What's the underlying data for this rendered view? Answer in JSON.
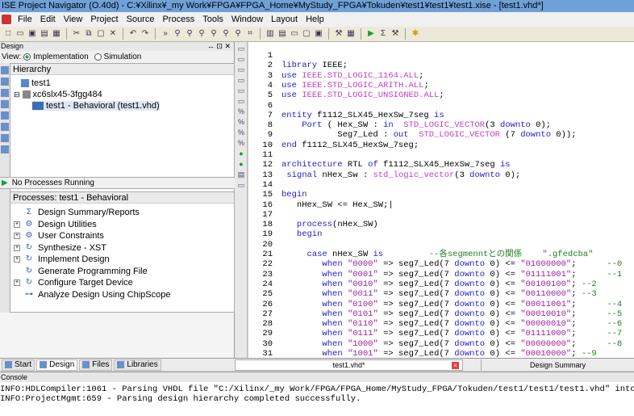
{
  "window": {
    "title": "ISE Project Navigator (O.40d) - C:¥Xilinx¥_my Work¥FPGA¥FPGA_Home¥MyStudy_FPGA¥Tokuden¥test1¥test1¥test1.xise - [test1.vhd*]"
  },
  "menu": [
    "File",
    "Edit",
    "View",
    "Project",
    "Source",
    "Process",
    "Tools",
    "Window",
    "Layout",
    "Help"
  ],
  "design_panel": {
    "header": "Design",
    "controls": "↔ ⊡ ✕",
    "view_label": "View:",
    "view_implementation": "Implementation",
    "view_simulation": "Simulation",
    "hierarchy_title": "Hierarchy",
    "tree": [
      {
        "label": "test1"
      },
      {
        "label": "xc6slx45-3fgg484"
      },
      {
        "label": "test1 - Behavioral (test1.vhd)"
      }
    ],
    "no_processes": "No Processes Running",
    "processes_title": "Processes: test1 - Behavioral",
    "processes": [
      {
        "label": "Design Summary/Reports",
        "expander": false,
        "icon": "Σ"
      },
      {
        "label": "Design Utilities",
        "expander": true,
        "icon": "⚙"
      },
      {
        "label": "User Constraints",
        "expander": true,
        "icon": "⚙"
      },
      {
        "label": "Synthesize - XST",
        "expander": true,
        "icon": "↻"
      },
      {
        "label": "Implement Design",
        "expander": true,
        "icon": "↻"
      },
      {
        "label": "Generate Programming File",
        "expander": false,
        "icon": "↻"
      },
      {
        "label": "Configure Target Device",
        "expander": true,
        "icon": "↻"
      },
      {
        "label": "Analyze Design Using ChipScope",
        "expander": false,
        "icon": "⊶"
      }
    ],
    "tabs": [
      "Start",
      "Design",
      "Files",
      "Libraries"
    ]
  },
  "editor": {
    "lines": [
      {
        "n": "1",
        "html": ""
      },
      {
        "n": "2",
        "html": "<span class=\"kw\">library</span> IEEE;"
      },
      {
        "n": "3",
        "html": "<span class=\"kw\">use</span> <span class=\"ty\">IEEE.STD_LOGIC_1164.ALL</span>;"
      },
      {
        "n": "4",
        "html": "<span class=\"kw\">use</span> <span class=\"ty\">IEEE.STD_LOGIC_ARITH.ALL</span>;"
      },
      {
        "n": "5",
        "html": "<span class=\"kw\">use</span> <span class=\"ty\">IEEE.STD_LOGIC_UNSIGNED.ALL</span>;"
      },
      {
        "n": "6",
        "html": ""
      },
      {
        "n": "7",
        "html": "<span class=\"kw\">entity</span> f1112_SLX45_HexSw_7seg <span class=\"kw\">is</span>"
      },
      {
        "n": "8",
        "html": "    <span class=\"kw\">Port</span> ( Hex_SW : <span class=\"kw\">in</span>  <span class=\"ty\">STD_LOGIC_VECTOR</span>(3 <span class=\"kw\">downto</span> 0);"
      },
      {
        "n": "9",
        "html": "           Seg7_Led : <span class=\"kw\">out</span>  <span class=\"ty\">STD_LOGIC_VECTOR</span> (7 <span class=\"kw\">downto</span> 0));"
      },
      {
        "n": "10",
        "html": "<span class=\"kw\">end</span> f1112_SLX45_HexSw_7seg;"
      },
      {
        "n": "11",
        "html": ""
      },
      {
        "n": "12",
        "html": "<span class=\"kw\">architecture</span> RTL <span class=\"kw\">of</span> f1112_SLX45_HexSw_7seg <span class=\"kw\">is</span>"
      },
      {
        "n": "13",
        "html": " <span class=\"kw\">signal</span> nHex_Sw : <span class=\"ty\">std_logic_vector</span>(3 <span class=\"kw\">downto</span> 0);"
      },
      {
        "n": "14",
        "html": ""
      },
      {
        "n": "15",
        "html": "<span class=\"kw\">begin</span>"
      },
      {
        "n": "16",
        "html": "   nHex_SW &lt;= Hex_SW;|"
      },
      {
        "n": "17",
        "html": ""
      },
      {
        "n": "18",
        "html": "   <span class=\"kw\">process</span>(nHex_SW)"
      },
      {
        "n": "19",
        "html": "   <span class=\"kw\">begin</span>"
      },
      {
        "n": "20",
        "html": ""
      },
      {
        "n": "21",
        "html": "     <span class=\"kw\">case</span> nHex_SW <span class=\"kw\">is</span>         <span class=\"cm\">--各segmenntとの関係    \".gfedcba\"</span>"
      },
      {
        "n": "22",
        "html": "        <span class=\"kw\">when</span> <span class=\"str\">\"0000\"</span> =&gt; seg7_Led(7 <span class=\"kw\">downto</span> 0) &lt;= <span class=\"str\">\"01000000\"</span>;      <span class=\"cm\">--0</span>"
      },
      {
        "n": "23",
        "html": "        <span class=\"kw\">when</span> <span class=\"str\">\"0001\"</span> =&gt; seg7_Led(7 <span class=\"kw\">downto</span> 0) &lt;= <span class=\"str\">\"01111001\"</span>;      <span class=\"cm\">--1</span>"
      },
      {
        "n": "24",
        "html": "        <span class=\"kw\">when</span> <span class=\"str\">\"0010\"</span> =&gt; seg7_Led(7 <span class=\"kw\">downto</span> 0) &lt;= <span class=\"str\">\"00100100\"</span>; <span class=\"cm\">--2</span>"
      },
      {
        "n": "25",
        "html": "        <span class=\"kw\">when</span> <span class=\"str\">\"0011\"</span> =&gt; seg7_Led(7 <span class=\"kw\">downto</span> 0) &lt;= <span class=\"str\">\"00110000\"</span>; <span class=\"cm\">--3</span>"
      },
      {
        "n": "26",
        "html": "        <span class=\"kw\">when</span> <span class=\"str\">\"0100\"</span> =&gt; seg7_Led(7 <span class=\"kw\">downto</span> 0) &lt;= <span class=\"str\">\"00011001\"</span>;      <span class=\"cm\">--4</span>"
      },
      {
        "n": "27",
        "html": "        <span class=\"kw\">when</span> <span class=\"str\">\"0101\"</span> =&gt; seg7_Led(7 <span class=\"kw\">downto</span> 0) &lt;= <span class=\"str\">\"00010010\"</span>;      <span class=\"cm\">--5</span>"
      },
      {
        "n": "28",
        "html": "        <span class=\"kw\">when</span> <span class=\"str\">\"0110\"</span> =&gt; seg7_Led(7 <span class=\"kw\">downto</span> 0) &lt;= <span class=\"str\">\"00000010\"</span>;      <span class=\"cm\">--6</span>"
      },
      {
        "n": "29",
        "html": "        <span class=\"kw\">when</span> <span class=\"str\">\"0111\"</span> =&gt; seg7_Led(7 <span class=\"kw\">downto</span> 0) &lt;= <span class=\"str\">\"01111000\"</span>;      <span class=\"cm\">--7</span>"
      },
      {
        "n": "30",
        "html": "        <span class=\"kw\">when</span> <span class=\"str\">\"1000\"</span> =&gt; seg7_Led(7 <span class=\"kw\">downto</span> 0) &lt;= <span class=\"str\">\"00000000\"</span>;      <span class=\"cm\">--8</span>"
      },
      {
        "n": "31",
        "html": "        <span class=\"kw\">when</span> <span class=\"str\">\"1001\"</span> =&gt; seg7_Led(7 <span class=\"kw\">downto</span> 0) &lt;= <span class=\"str\">\"00010000\"</span>; <span class=\"cm\">--9</span>"
      }
    ],
    "tabs": {
      "file": "test1.vhd*",
      "summary": "Design Summary"
    }
  },
  "console": {
    "title": "Console",
    "lines": [
      "INFO:HDLCompiler:1061 - Parsing VHDL file \"C:/Xilinx/_my Work/FPGA/FPGA_Home/MyStudy_FPGA/Tokuden/test1/test1/test1.vhd\" into libr",
      "INFO:ProjectMgmt:659 - Parsing design hierarchy completed successfully."
    ]
  }
}
